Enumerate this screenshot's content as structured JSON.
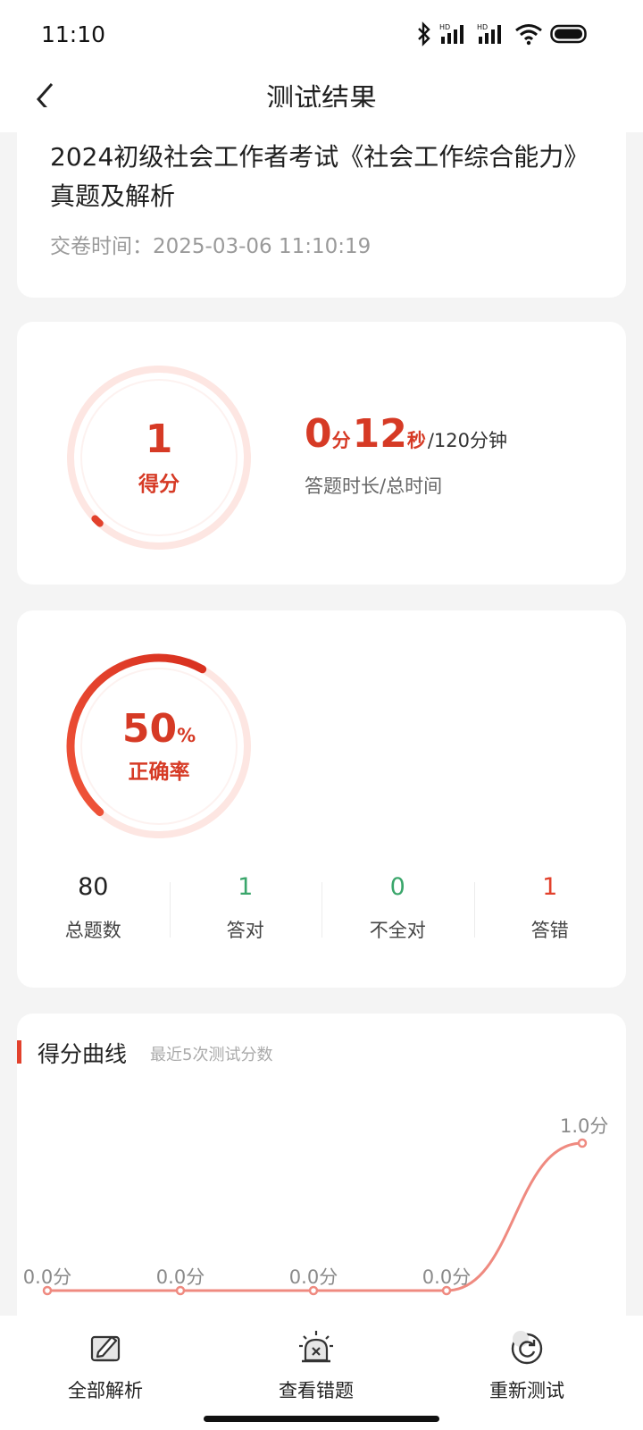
{
  "status": {
    "time": "11:10"
  },
  "nav": {
    "title": "测试结果"
  },
  "exam": {
    "title": "2024初级社会工作者考试《社会工作综合能力》真题及解析",
    "submit_time": "交卷时间：2025-03-06 11:10:19"
  },
  "score": {
    "value": "1",
    "label": "得分",
    "minutes": "0",
    "minutes_unit": "分",
    "seconds": "12",
    "seconds_unit": "秒",
    "total": "/120分钟",
    "caption": "答题时长/总时间",
    "fill_fraction": 0.012
  },
  "accuracy": {
    "value": "50",
    "unit": "%",
    "label": "正确率",
    "fill_fraction": 0.5,
    "stats": [
      {
        "value": "80",
        "label": "总题数"
      },
      {
        "value": "1",
        "label": "答对"
      },
      {
        "value": "0",
        "label": "不全对"
      },
      {
        "value": "1",
        "label": "答错"
      }
    ]
  },
  "curve": {
    "title": "得分曲线",
    "subtitle": "最近5次测试分数",
    "chart_data": {
      "type": "line",
      "x": [
        1,
        2,
        3,
        4,
        5
      ],
      "values": [
        0.0,
        0.0,
        0.0,
        0.0,
        1.0
      ],
      "point_labels": [
        "0.0分",
        "0.0分",
        "0.0分",
        "0.0分",
        "1.0分"
      ],
      "ylim": [
        0,
        1
      ]
    }
  },
  "bottom": [
    {
      "label": "全部解析",
      "icon": "pencil-edit-icon"
    },
    {
      "label": "查看错题",
      "icon": "alarm-light-icon"
    },
    {
      "label": "重新测试",
      "icon": "refresh-icon"
    }
  ],
  "colors": {
    "accent": "#d63a25",
    "green": "#3aa66b",
    "red": "#e2412c"
  }
}
